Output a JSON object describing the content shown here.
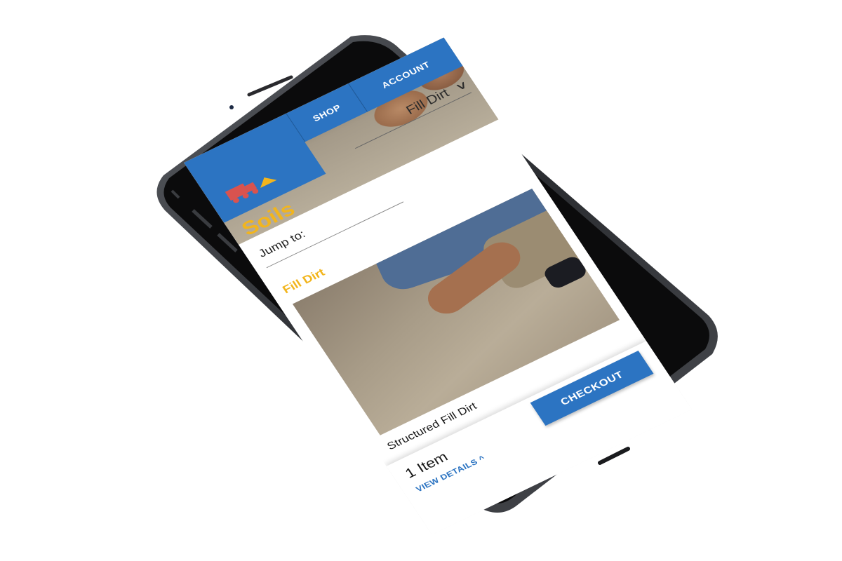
{
  "nav": {
    "shop_label": "SHOP",
    "account_label": "ACCOUNT"
  },
  "page": {
    "title": "Soils",
    "selected_category": "Fill Dirt",
    "jump_label": "Jump to:"
  },
  "section": {
    "title": "Fill Dirt",
    "product_name": "Structured Fill Dirt"
  },
  "cart": {
    "count_text": "1 Item",
    "view_details_label": "VIEW DETAILS ^",
    "checkout_label": "CHECKOUT"
  },
  "colors": {
    "brand_blue": "#2c74c2",
    "accent_yellow": "#f2b51d"
  }
}
